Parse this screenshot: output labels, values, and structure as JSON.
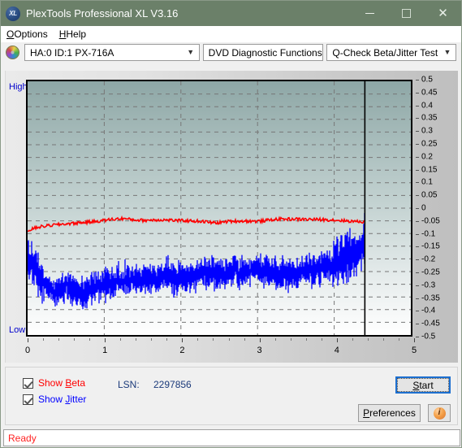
{
  "window": {
    "title": "PlexTools Professional XL V3.16",
    "app_icon": "xl-logo-icon",
    "minimize": "minimize-icon",
    "maximize": "maximize-icon",
    "close": "close-icon"
  },
  "menu": {
    "items": [
      {
        "label": "Options",
        "accel": "O"
      },
      {
        "label": "Help",
        "accel": "H"
      }
    ]
  },
  "toolbar": {
    "disc_icon": "disc-icon",
    "drive_select": "HA:0 ID:1  PX-716A",
    "function_select": "DVD Diagnostic Functions",
    "test_select": "Q-Check Beta/Jitter Test"
  },
  "chart": {
    "high_label": "High",
    "low_label": "Low"
  },
  "controls": {
    "show_beta_label": "Show Beta",
    "show_beta_accel": "B",
    "show_beta_checked": true,
    "show_jitter_label": "Show Jitter",
    "show_jitter_accel": "J",
    "show_jitter_checked": true,
    "lsn_label": "LSN:",
    "lsn_value": "2297856",
    "start_label": "Start",
    "start_accel": "S",
    "preferences_label": "Preferences",
    "preferences_accel": "P",
    "info_icon": "info-icon",
    "info_glyph": "i"
  },
  "statusbar": {
    "text": "Ready"
  },
  "colors": {
    "titlebar": "#6b8069",
    "beta_line": "#ff0000",
    "jitter_line": "#0000ff",
    "axis_label": "#0000cc",
    "lsn_text": "#1b3a7a",
    "status_text": "#ff2222",
    "focus_border": "#1c6fd0"
  },
  "chart_data": {
    "type": "line",
    "title": "Q-Check Beta/Jitter Test",
    "xlabel": "",
    "ylabel": "",
    "xlim": [
      0,
      5
    ],
    "ylim": [
      -0.5,
      0.5
    ],
    "grid": true,
    "legend_position": "bottom-left",
    "x_ticks": [
      0,
      1,
      2,
      3,
      4,
      5
    ],
    "y_ticks": [
      0.5,
      0.45,
      0.4,
      0.35,
      0.3,
      0.25,
      0.2,
      0.15,
      0.1,
      0.05,
      0,
      -0.05,
      -0.1,
      -0.15,
      -0.2,
      -0.25,
      -0.3,
      -0.35,
      -0.4,
      -0.45,
      -0.5
    ],
    "data_end_marker_x": 4.4,
    "axis_corner_labels": {
      "top_left": "High",
      "bottom_left": "Low"
    },
    "series": [
      {
        "name": "Beta",
        "color": "#ff0000",
        "x": [
          0.0,
          0.05,
          0.1,
          0.15,
          0.2,
          0.25,
          0.3,
          0.35,
          0.4,
          0.45,
          0.5,
          0.55,
          0.6,
          0.65,
          0.7,
          0.75,
          0.8,
          0.85,
          0.9,
          0.95,
          1.0,
          1.05,
          1.1,
          1.15,
          1.2,
          1.25,
          1.3,
          1.35,
          1.4,
          1.45,
          1.5,
          1.55,
          1.6,
          1.65,
          1.7,
          1.75,
          1.8,
          1.85,
          1.9,
          1.95,
          2.0,
          2.05,
          2.1,
          2.15,
          2.2,
          2.25,
          2.3,
          2.35,
          2.4,
          2.45,
          2.5,
          2.55,
          2.6,
          2.65,
          2.7,
          2.75,
          2.8,
          2.85,
          2.9,
          2.95,
          3.0,
          3.05,
          3.1,
          3.15,
          3.2,
          3.25,
          3.3,
          3.35,
          3.4,
          3.45,
          3.5,
          3.55,
          3.6,
          3.65,
          3.7,
          3.75,
          3.8,
          3.85,
          3.9,
          3.95,
          4.0,
          4.05,
          4.1,
          4.15,
          4.2,
          4.25,
          4.3,
          4.35,
          4.4
        ],
        "y": [
          -0.09,
          -0.083,
          -0.078,
          -0.074,
          -0.072,
          -0.07,
          -0.068,
          -0.066,
          -0.065,
          -0.063,
          -0.062,
          -0.061,
          -0.06,
          -0.058,
          -0.057,
          -0.056,
          -0.055,
          -0.053,
          -0.052,
          -0.05,
          -0.048,
          -0.046,
          -0.044,
          -0.043,
          -0.042,
          -0.041,
          -0.043,
          -0.045,
          -0.046,
          -0.047,
          -0.048,
          -0.048,
          -0.047,
          -0.046,
          -0.046,
          -0.046,
          -0.047,
          -0.047,
          -0.048,
          -0.049,
          -0.049,
          -0.049,
          -0.05,
          -0.05,
          -0.051,
          -0.052,
          -0.053,
          -0.055,
          -0.057,
          -0.058,
          -0.057,
          -0.055,
          -0.053,
          -0.052,
          -0.051,
          -0.051,
          -0.051,
          -0.051,
          -0.051,
          -0.052,
          -0.052,
          -0.051,
          -0.049,
          -0.047,
          -0.045,
          -0.044,
          -0.043,
          -0.043,
          -0.043,
          -0.043,
          -0.043,
          -0.044,
          -0.044,
          -0.044,
          -0.044,
          -0.045,
          -0.045,
          -0.045,
          -0.046,
          -0.046,
          -0.047,
          -0.048,
          -0.049,
          -0.05,
          -0.051,
          -0.052,
          -0.053,
          -0.053,
          -0.054
        ],
        "note": "Red beta trace, mean near -0.05, noisy +/-0.008"
      },
      {
        "name": "Jitter",
        "color": "#0000ff",
        "x": [
          0.0,
          0.05,
          0.1,
          0.15,
          0.2,
          0.25,
          0.3,
          0.35,
          0.4,
          0.45,
          0.5,
          0.55,
          0.6,
          0.65,
          0.7,
          0.75,
          0.8,
          0.85,
          0.9,
          0.95,
          1.0,
          1.05,
          1.1,
          1.15,
          1.2,
          1.25,
          1.3,
          1.35,
          1.4,
          1.45,
          1.5,
          1.55,
          1.6,
          1.65,
          1.7,
          1.75,
          1.8,
          1.85,
          1.9,
          1.95,
          2.0,
          2.05,
          2.1,
          2.15,
          2.2,
          2.25,
          2.3,
          2.35,
          2.4,
          2.45,
          2.5,
          2.55,
          2.6,
          2.65,
          2.7,
          2.75,
          2.8,
          2.85,
          2.9,
          2.95,
          3.0,
          3.05,
          3.1,
          3.15,
          3.2,
          3.25,
          3.3,
          3.35,
          3.4,
          3.45,
          3.5,
          3.55,
          3.6,
          3.65,
          3.7,
          3.75,
          3.8,
          3.85,
          3.9,
          3.95,
          4.0,
          4.05,
          4.1,
          4.15,
          4.2,
          4.25,
          4.3,
          4.35,
          4.4
        ],
        "y": [
          -0.2,
          -0.215,
          -0.25,
          -0.27,
          -0.29,
          -0.31,
          -0.32,
          -0.33,
          -0.325,
          -0.315,
          -0.3,
          -0.305,
          -0.32,
          -0.33,
          -0.335,
          -0.33,
          -0.32,
          -0.315,
          -0.31,
          -0.305,
          -0.3,
          -0.295,
          -0.292,
          -0.29,
          -0.288,
          -0.285,
          -0.283,
          -0.282,
          -0.28,
          -0.28,
          -0.278,
          -0.277,
          -0.276,
          -0.275,
          -0.272,
          -0.27,
          -0.265,
          -0.268,
          -0.272,
          -0.275,
          -0.275,
          -0.272,
          -0.268,
          -0.265,
          -0.262,
          -0.26,
          -0.258,
          -0.255,
          -0.252,
          -0.25,
          -0.255,
          -0.258,
          -0.255,
          -0.25,
          -0.248,
          -0.252,
          -0.255,
          -0.252,
          -0.248,
          -0.245,
          -0.24,
          -0.242,
          -0.245,
          -0.248,
          -0.25,
          -0.252,
          -0.255,
          -0.258,
          -0.258,
          -0.255,
          -0.252,
          -0.248,
          -0.245,
          -0.248,
          -0.25,
          -0.245,
          -0.24,
          -0.235,
          -0.228,
          -0.22,
          -0.215,
          -0.21,
          -0.205,
          -0.2,
          -0.19,
          -0.18,
          -0.17,
          -0.16,
          -0.13
        ],
        "note": "Blue jitter trace, band roughly -0.18 to -0.38, rising toward end"
      }
    ]
  }
}
